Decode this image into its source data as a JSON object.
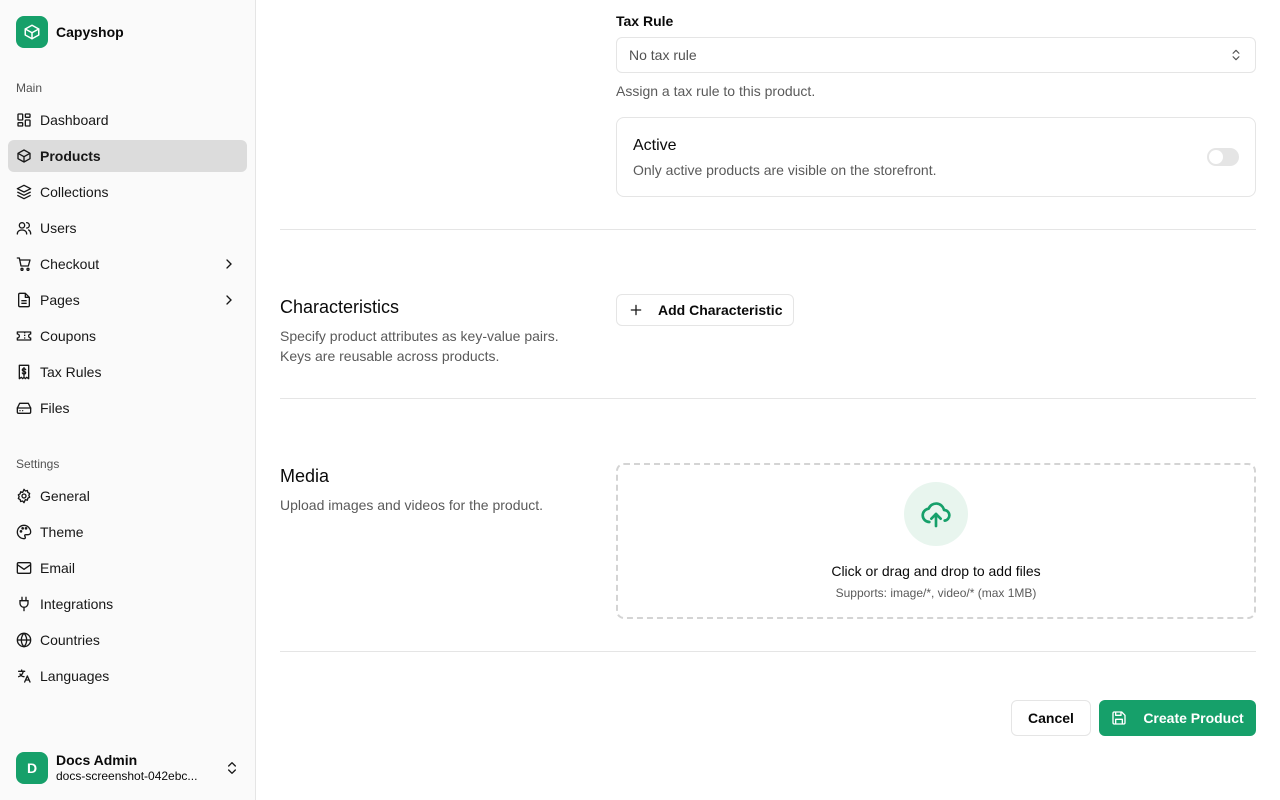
{
  "brand": {
    "name": "Capyshop",
    "icon": "box-icon",
    "color": "#16a06a"
  },
  "sidebar": {
    "main_label": "Main",
    "main_items": [
      {
        "label": "Dashboard",
        "icon": "dashboard-icon"
      },
      {
        "label": "Products",
        "icon": "box-icon",
        "active": true
      },
      {
        "label": "Collections",
        "icon": "layers-icon"
      },
      {
        "label": "Users",
        "icon": "users-icon"
      },
      {
        "label": "Checkout",
        "icon": "cart-icon",
        "has_children": true
      },
      {
        "label": "Pages",
        "icon": "file-icon",
        "has_children": true
      },
      {
        "label": "Coupons",
        "icon": "ticket-icon"
      },
      {
        "label": "Tax Rules",
        "icon": "receipt-icon"
      },
      {
        "label": "Files",
        "icon": "drive-icon"
      }
    ],
    "settings_label": "Settings",
    "settings_items": [
      {
        "label": "General",
        "icon": "gear-icon"
      },
      {
        "label": "Theme",
        "icon": "palette-icon"
      },
      {
        "label": "Email",
        "icon": "mail-icon"
      },
      {
        "label": "Integrations",
        "icon": "plug-icon"
      },
      {
        "label": "Countries",
        "icon": "globe-icon"
      },
      {
        "label": "Languages",
        "icon": "translate-icon"
      }
    ]
  },
  "user": {
    "initial": "D",
    "name": "Docs Admin",
    "email": "docs-screenshot-042ebc..."
  },
  "tax_rule": {
    "label": "Tax Rule",
    "selected": "No tax rule",
    "help": "Assign a tax rule to this product."
  },
  "active": {
    "title": "Active",
    "description": "Only active products are visible on the storefront.",
    "enabled": false
  },
  "characteristics": {
    "title": "Characteristics",
    "description": "Specify product attributes as key-value pairs. Keys are reusable across products.",
    "add_label": "Add Characteristic"
  },
  "media": {
    "title": "Media",
    "description": "Upload images and videos for the product.",
    "drop_title": "Click or drag and drop to add files",
    "drop_sub": "Supports: image/*, video/* (max 1MB)"
  },
  "actions": {
    "cancel_label": "Cancel",
    "create_label": "Create Product"
  }
}
